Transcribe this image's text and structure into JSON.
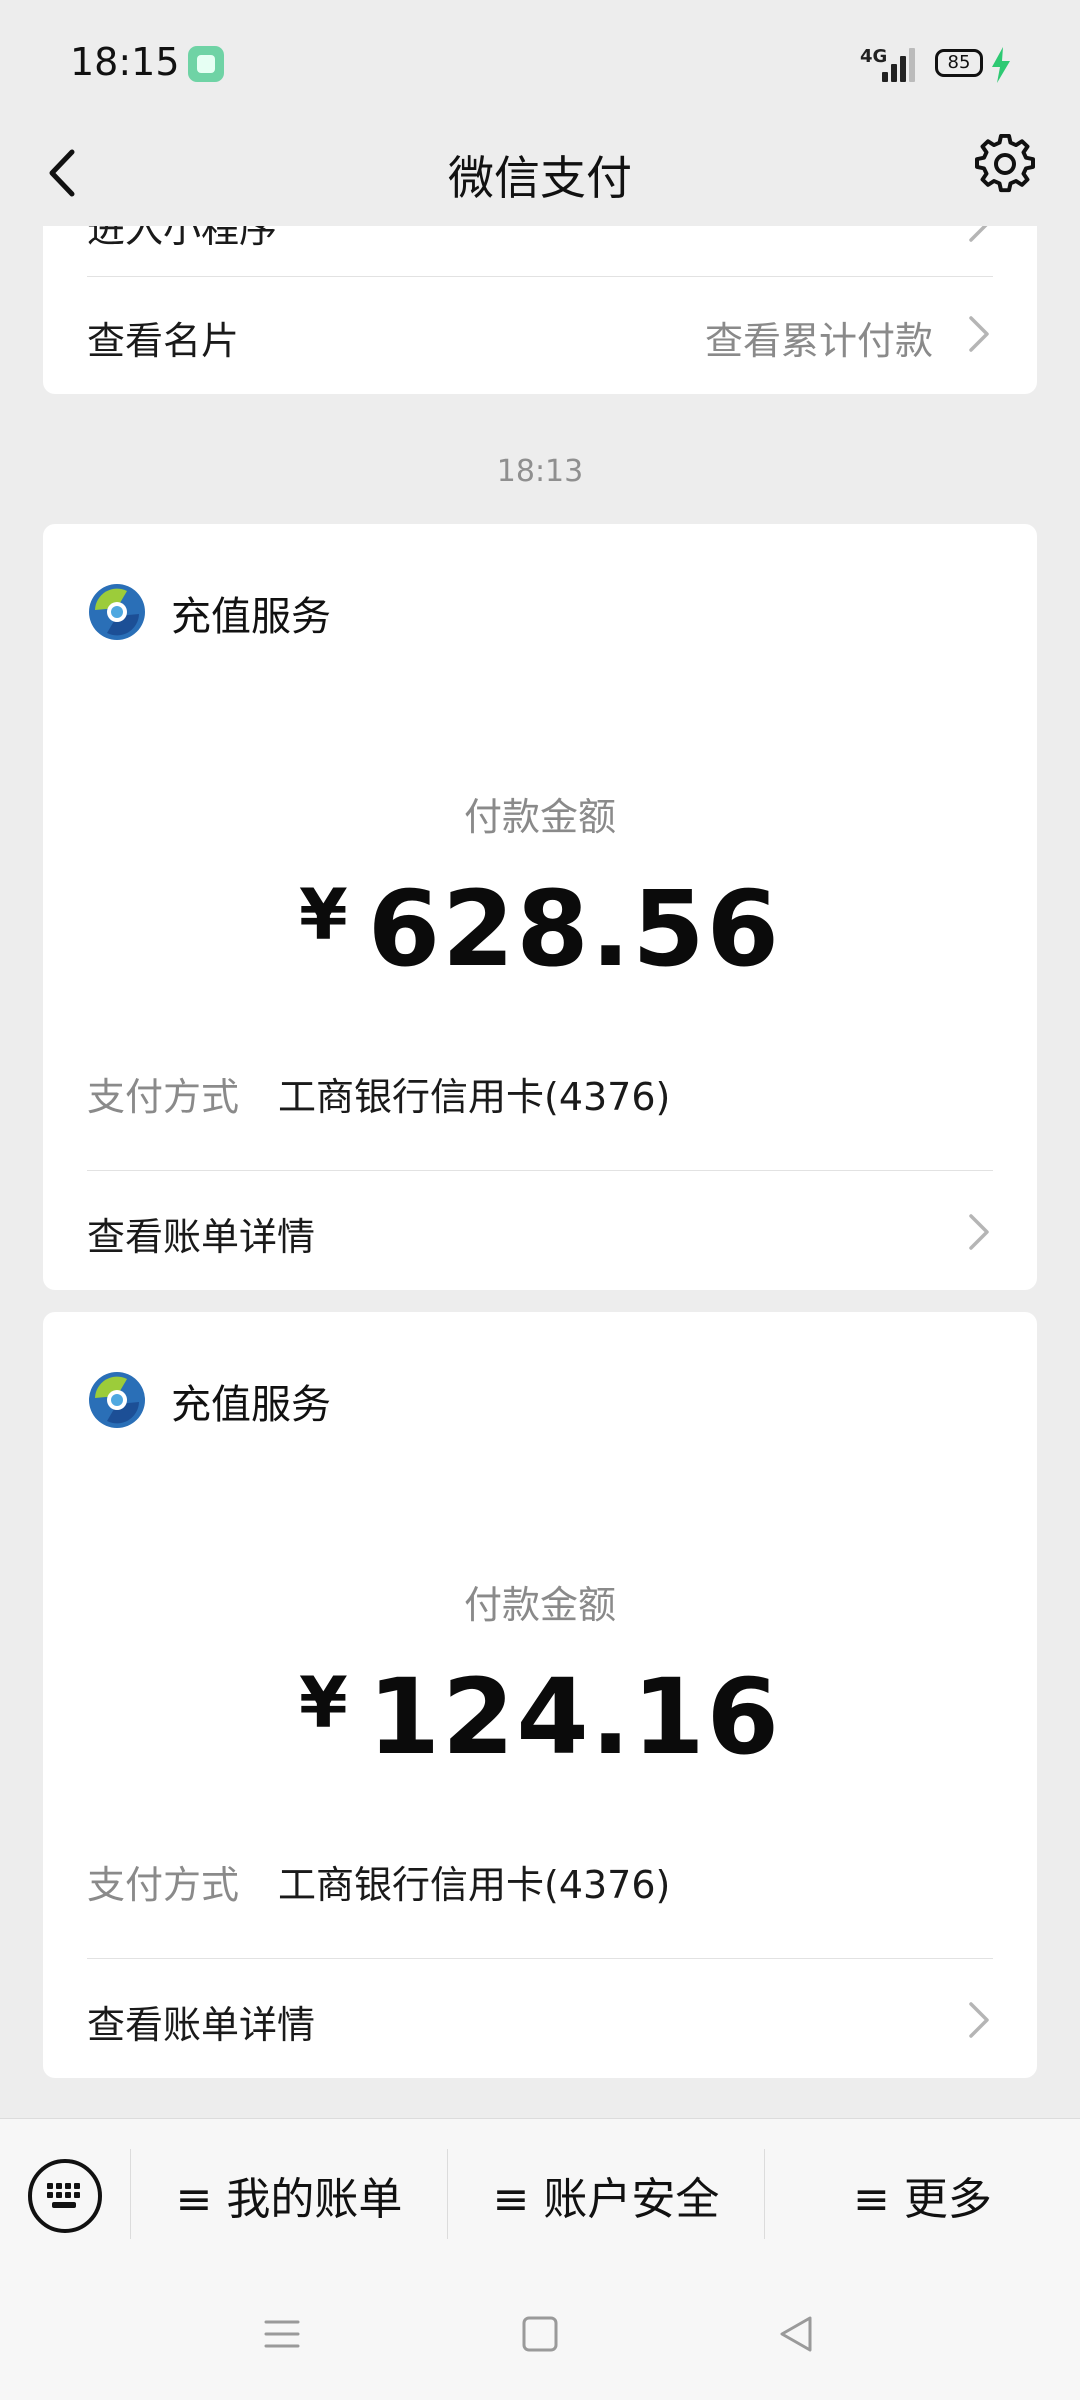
{
  "status_bar": {
    "time": "18:15",
    "network": "4G",
    "battery": "85"
  },
  "nav": {
    "title": "微信支付"
  },
  "top_card": {
    "partial_label": "进入小程序",
    "card_label": "查看名片",
    "card_right": "查看累计付款"
  },
  "timestamp": "18:13",
  "payments": [
    {
      "service": "充值服务",
      "amount_label": "付款金额",
      "currency": "¥",
      "amount": "628.56",
      "method_label": "支付方式",
      "method_value": "工商银行信用卡(4376)",
      "details_label": "查看账单详情"
    },
    {
      "service": "充值服务",
      "amount_label": "付款金额",
      "currency": "¥",
      "amount": "124.16",
      "method_label": "支付方式",
      "method_value": "工商银行信用卡(4376)",
      "details_label": "查看账单详情"
    }
  ],
  "bottom_menu": {
    "items": [
      "≡ 我的账单",
      "≡ 账户安全",
      "≡ 更多"
    ]
  },
  "icons": {
    "back": "back-arrow-icon",
    "settings": "gear-icon",
    "keyboard": "keyboard-icon",
    "service": "recharge-service-logo"
  }
}
